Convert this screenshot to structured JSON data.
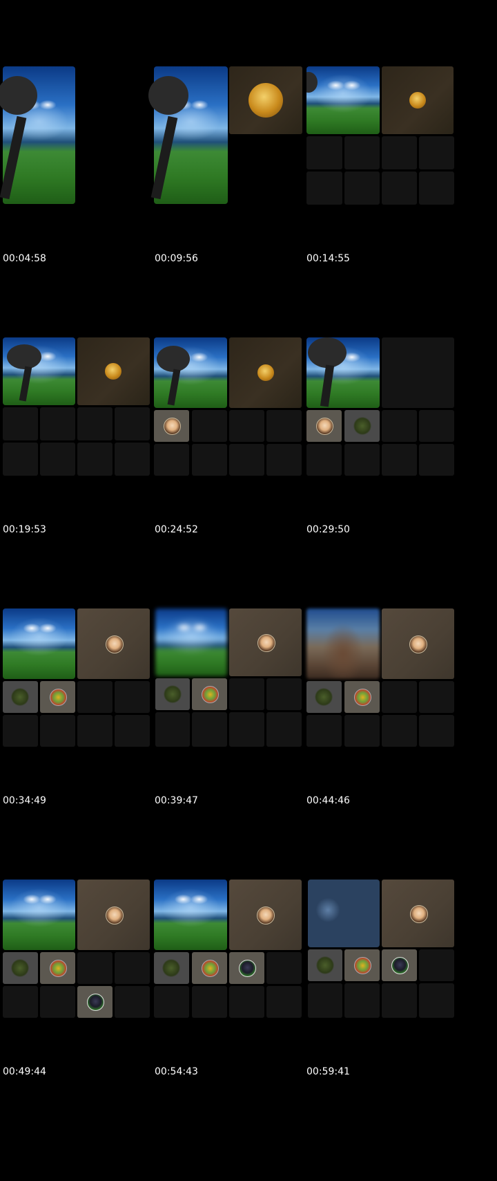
{
  "frames": [
    {
      "timestamp": "00:04:58"
    },
    {
      "timestamp": "00:09:56"
    },
    {
      "timestamp": "00:14:55"
    },
    {
      "timestamp": "00:19:53"
    },
    {
      "timestamp": "00:24:52"
    },
    {
      "timestamp": "00:29:50"
    },
    {
      "timestamp": "00:34:49"
    },
    {
      "timestamp": "00:39:47"
    },
    {
      "timestamp": "00:44:46"
    },
    {
      "timestamp": "00:49:44"
    },
    {
      "timestamp": "00:54:43"
    },
    {
      "timestamp": "00:59:41"
    }
  ]
}
